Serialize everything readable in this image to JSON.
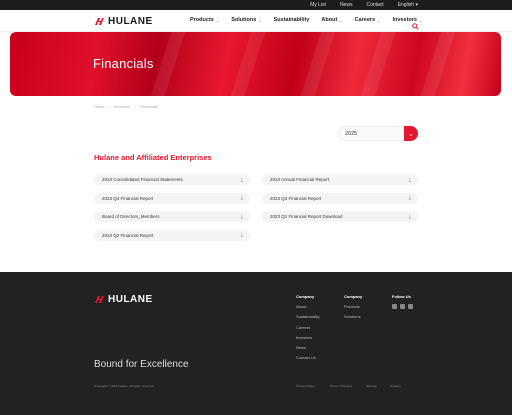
{
  "topbar": {
    "links": [
      "My List",
      "News",
      "Contact"
    ],
    "language": "English"
  },
  "brand": {
    "name": "HULANE",
    "accent": "#e3172d"
  },
  "nav": {
    "items": [
      "Products",
      "Solutions",
      "Sustainability",
      "About",
      "Careers",
      "Investors"
    ]
  },
  "hero": {
    "title": "Financials"
  },
  "breadcrumb": [
    "Home",
    "Investors",
    "Financials"
  ],
  "year_select": {
    "value": "2025"
  },
  "section": {
    "title": "Hulane and Affiliated Enterprises"
  },
  "documents": [
    "2023 Consolidated Financial Statements",
    "2023 Annual Financial Report",
    "2023 Q4 Financial Report",
    "2023 Q3 Financial Report",
    "Board of Directors_Members",
    "2023 Q1 Financial Report Download",
    "2023 Q2 Financial Report"
  ],
  "footer": {
    "company": {
      "heading": "Company",
      "items": [
        "About",
        "Sustainability",
        "Careers",
        "Investors",
        "News",
        "Contact Us"
      ]
    },
    "company2": {
      "heading": "Company",
      "items": [
        "Products",
        "Solutions"
      ]
    },
    "follow": {
      "heading": "Follow Us"
    },
    "tagline": "Bound for Excellence",
    "copyright": "Copyright © 2024 Hulane. All rights reserved.",
    "links": [
      "Privacy Policy",
      "Terms of Service",
      "Sitemap",
      "Cookies"
    ]
  }
}
